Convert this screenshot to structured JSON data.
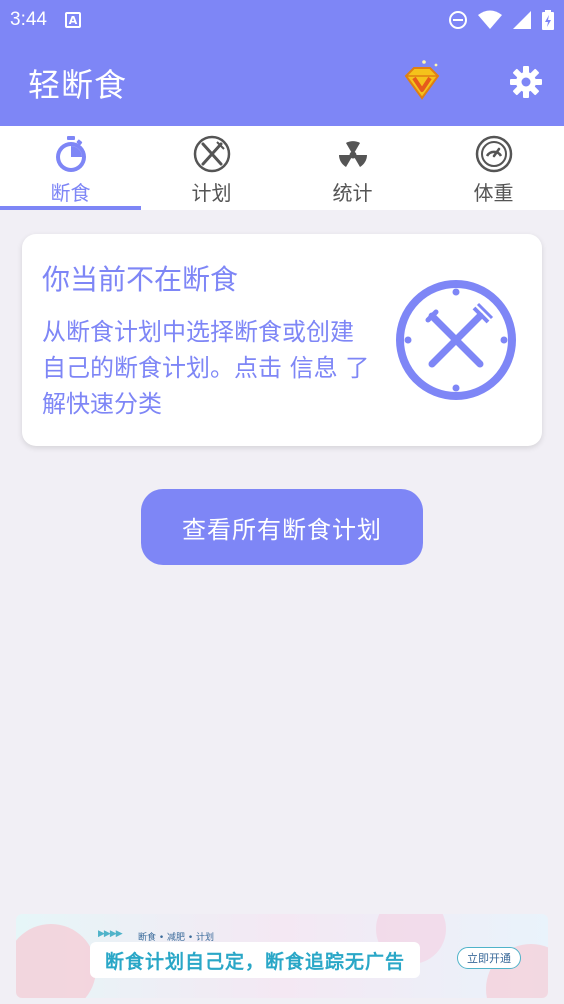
{
  "status_bar": {
    "time": "3:44",
    "notification_icon": "A"
  },
  "app_bar": {
    "title": "轻断食"
  },
  "tabs": [
    {
      "label": "断食",
      "icon": "stopwatch-icon",
      "active": true
    },
    {
      "label": "计划",
      "icon": "utensils-icon",
      "active": false
    },
    {
      "label": "统计",
      "icon": "radiation-icon",
      "active": false
    },
    {
      "label": "体重",
      "icon": "gauge-icon",
      "active": false
    }
  ],
  "card": {
    "heading": "你当前不在断食",
    "body": "从断食计划中选择断食或创建自己的断食计划。点击 信息 了解快速分类"
  },
  "main_button": {
    "label": "查看所有断食计划"
  },
  "ad": {
    "small_text": "断食 • 减肥 • 计划",
    "arrows": "▶▶▶▶",
    "headline": "断食计划自己定，断食追踪无广告",
    "cta": "立即开通"
  },
  "colors": {
    "primary": "#7e86f6",
    "background": "#f1eff5",
    "ad_accent": "#2aa7c7"
  }
}
